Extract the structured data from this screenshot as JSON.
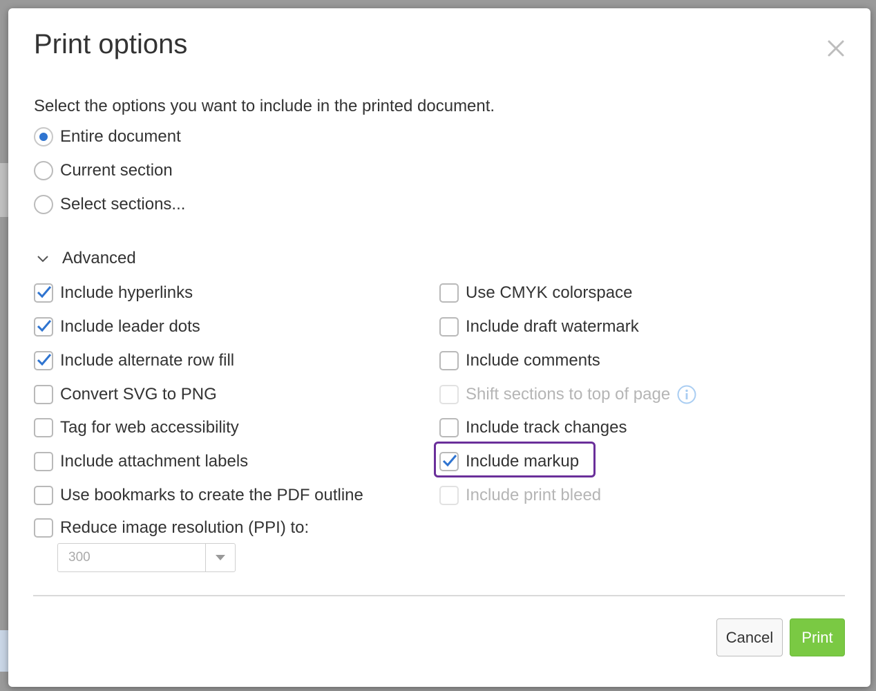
{
  "dialog": {
    "title": "Print options",
    "description": "Select the options you want to include in the printed document.",
    "close_icon": "close-icon"
  },
  "scope": {
    "options": [
      {
        "label": "Entire document",
        "selected": true
      },
      {
        "label": "Current section",
        "selected": false
      },
      {
        "label": "Select sections...",
        "selected": false
      }
    ]
  },
  "advanced": {
    "label": "Advanced",
    "expanded": true,
    "left_column": [
      {
        "label": "Include hyperlinks",
        "checked": true
      },
      {
        "label": "Include leader dots",
        "checked": true
      },
      {
        "label": "Include alternate row fill",
        "checked": true
      },
      {
        "label": "Convert SVG to PNG",
        "checked": false
      },
      {
        "label": "Tag for web accessibility",
        "checked": false
      },
      {
        "label": "Include attachment labels",
        "checked": false
      },
      {
        "label": "Use bookmarks to create the PDF outline",
        "checked": false
      },
      {
        "label": "Reduce image resolution (PPI) to:",
        "checked": false
      }
    ],
    "right_column": [
      {
        "label": "Use CMYK colorspace",
        "checked": false,
        "disabled": false
      },
      {
        "label": "Include draft watermark",
        "checked": false,
        "disabled": false
      },
      {
        "label": "Include comments",
        "checked": false,
        "disabled": false
      },
      {
        "label": "Shift sections to top of page",
        "checked": false,
        "disabled": true
      },
      {
        "label": "Include track changes",
        "checked": false,
        "disabled": false
      },
      {
        "label": "Include markup",
        "checked": true,
        "disabled": false
      },
      {
        "label": "Include print bleed",
        "checked": false,
        "disabled": true
      }
    ],
    "ppi_select": {
      "value": "300"
    }
  },
  "footer": {
    "cancel_label": "Cancel",
    "print_label": "Print"
  },
  "colors": {
    "accent": "#2f74d0",
    "print_button": "#7ac943",
    "highlight": "#6a2f9a"
  }
}
